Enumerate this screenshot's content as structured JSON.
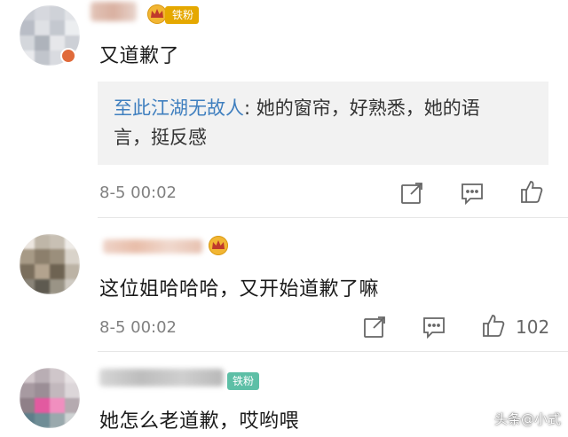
{
  "comments": [
    {
      "badge": "铁粉",
      "text": "又道歉了",
      "quote": {
        "author": "至此江湖无故人",
        "sep": ": ",
        "body_line1": "她的窗帘，好熟悉，她的语",
        "body_line2": "言，挺反感"
      },
      "time": "8-5 00:02"
    },
    {
      "text": "这位姐哈哈哈，又开始道歉了嘛",
      "time": "8-5 00:02",
      "likes": "102"
    },
    {
      "badge": "铁粉",
      "text": "她怎么老道歉，哎哟喂"
    }
  ],
  "watermark": "头条@小式",
  "colors": {
    "accent_link": "#3f7fbf",
    "badge_gold": "#e5a800",
    "badge_green": "#5dbfa6"
  },
  "icons": [
    "share-icon",
    "comment-icon",
    "like-icon",
    "crown-icon"
  ]
}
